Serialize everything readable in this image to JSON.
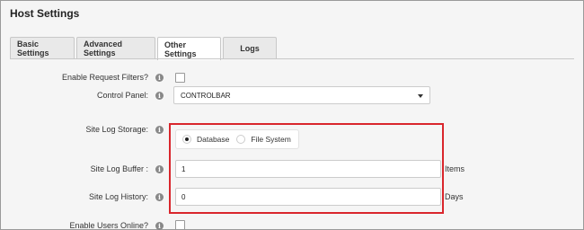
{
  "page": {
    "title": "Host Settings"
  },
  "tabs": [
    {
      "label": "Basic Settings",
      "active": false
    },
    {
      "label": "Advanced Settings",
      "active": false
    },
    {
      "label": "Other Settings",
      "active": true
    },
    {
      "label": "Logs",
      "active": false
    }
  ],
  "fields": {
    "enable_request_filters": {
      "label": "Enable Request Filters?",
      "checked": false
    },
    "control_panel": {
      "label": "Control Panel:",
      "value": "CONTROLBAR"
    },
    "site_log_storage": {
      "label": "Site Log Storage:",
      "options": [
        "Database",
        "File System"
      ],
      "selected": "Database"
    },
    "site_log_buffer": {
      "label": "Site Log Buffer :",
      "value": "1",
      "unit": "Items"
    },
    "site_log_history": {
      "label": "Site Log History:",
      "value": "0",
      "unit": "Days"
    },
    "enable_users_online": {
      "label": "Enable Users Online?",
      "checked": false
    }
  },
  "icons": {
    "info": "info-icon",
    "info_glyph": "i"
  },
  "colors": {
    "highlight_border": "#d9262c",
    "background": "#f5f5f5"
  }
}
